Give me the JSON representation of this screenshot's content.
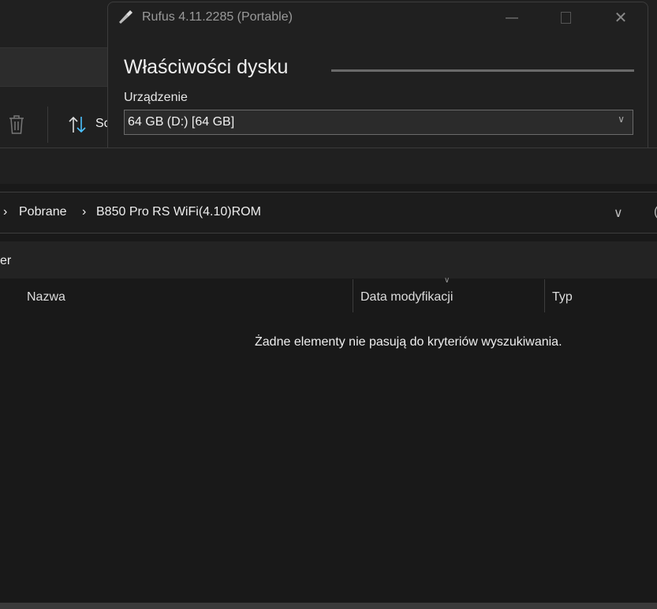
{
  "explorer": {
    "toolbar": {
      "sort_label_partial": "So"
    },
    "breadcrumb": [
      "Pobrane",
      "B850 Pro RS WiFi(4.10)ROM"
    ],
    "filter_partial": "er",
    "columns": [
      "Nazwa",
      "Data modyfikacji",
      "Typ"
    ],
    "empty_message": "Żadne elementy nie pasują do kryteriów wyszukiwania."
  },
  "rufus": {
    "title": "Rufus 4.11.2285 (Portable)",
    "section_heading": "Właściwości dysku",
    "device_label": "Urządzenie",
    "device_value": "64 GB (D:) [64 GB]"
  }
}
